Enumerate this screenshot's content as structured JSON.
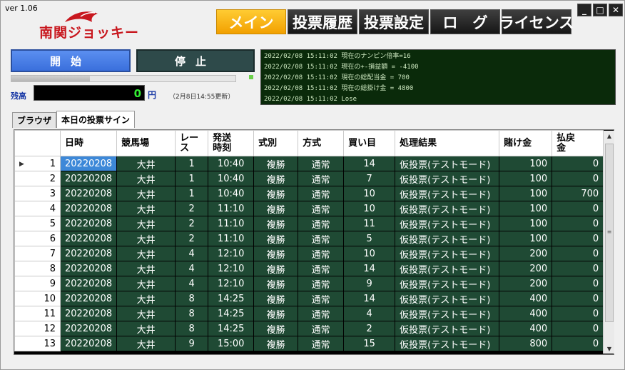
{
  "app": {
    "version": "ver 1.06",
    "logo_text": "南関ジョッキー"
  },
  "nav": {
    "tabs": [
      {
        "label": "メイン",
        "active": true
      },
      {
        "label": "投票履歴",
        "active": false
      },
      {
        "label": "投票設定",
        "active": false
      },
      {
        "label": "ロ　グ",
        "active": false
      },
      {
        "label": "ライセンス",
        "active": false
      }
    ]
  },
  "window_controls": {
    "minimize": "_",
    "maximize": "□",
    "close": "✕"
  },
  "controls": {
    "start_label": "開始",
    "stop_label": "停止",
    "progress_fraction": 0.35
  },
  "balance": {
    "label": "残高",
    "value": "0",
    "unit": "円",
    "note": "（2月8日14:55更新）"
  },
  "log": {
    "lines": [
      "2022/02/08 15:11:02  現在のナンピン倍率=16",
      "2022/02/08 15:11:02  現在の+-損益額 = -4100",
      "2022/02/08 15:11:02  現在の総配当金 = 700",
      "2022/02/08 15:11:02  現在の総掛け金 = 4800",
      "2022/02/08 15:11:02  Lose"
    ]
  },
  "subtabs": [
    {
      "label": "ブラウザ",
      "active": false
    },
    {
      "label": "本日の投票サイン",
      "active": true
    }
  ],
  "table": {
    "headers": [
      "日時",
      "競馬場",
      "レース",
      "発送時刻",
      "式別",
      "方式",
      "買い目",
      "処理結果",
      "賭け金",
      "払戻金"
    ],
    "header_display": [
      "日時",
      "競馬場",
      "レー\nス",
      "発送\n時刻",
      "式別",
      "方式",
      "買い目",
      "処理結果",
      "賭け金",
      "払戻\n金"
    ],
    "rows": [
      {
        "n": "1",
        "date": "20220208",
        "track": "大井",
        "race": "1",
        "time": "10:40",
        "type": "複勝",
        "method": "通常",
        "pick": "14",
        "result": "仮投票(テストモード)",
        "stake": "100",
        "payout": "0"
      },
      {
        "n": "2",
        "date": "20220208",
        "track": "大井",
        "race": "1",
        "time": "10:40",
        "type": "複勝",
        "method": "通常",
        "pick": "7",
        "result": "仮投票(テストモード)",
        "stake": "100",
        "payout": "0"
      },
      {
        "n": "3",
        "date": "20220208",
        "track": "大井",
        "race": "1",
        "time": "10:40",
        "type": "複勝",
        "method": "通常",
        "pick": "10",
        "result": "仮投票(テストモード)",
        "stake": "100",
        "payout": "700"
      },
      {
        "n": "4",
        "date": "20220208",
        "track": "大井",
        "race": "2",
        "time": "11:10",
        "type": "複勝",
        "method": "通常",
        "pick": "10",
        "result": "仮投票(テストモード)",
        "stake": "100",
        "payout": "0"
      },
      {
        "n": "5",
        "date": "20220208",
        "track": "大井",
        "race": "2",
        "time": "11:10",
        "type": "複勝",
        "method": "通常",
        "pick": "11",
        "result": "仮投票(テストモード)",
        "stake": "100",
        "payout": "0"
      },
      {
        "n": "6",
        "date": "20220208",
        "track": "大井",
        "race": "2",
        "time": "11:10",
        "type": "複勝",
        "method": "通常",
        "pick": "5",
        "result": "仮投票(テストモード)",
        "stake": "100",
        "payout": "0"
      },
      {
        "n": "7",
        "date": "20220208",
        "track": "大井",
        "race": "4",
        "time": "12:10",
        "type": "複勝",
        "method": "通常",
        "pick": "10",
        "result": "仮投票(テストモード)",
        "stake": "200",
        "payout": "0"
      },
      {
        "n": "8",
        "date": "20220208",
        "track": "大井",
        "race": "4",
        "time": "12:10",
        "type": "複勝",
        "method": "通常",
        "pick": "14",
        "result": "仮投票(テストモード)",
        "stake": "200",
        "payout": "0"
      },
      {
        "n": "9",
        "date": "20220208",
        "track": "大井",
        "race": "4",
        "time": "12:10",
        "type": "複勝",
        "method": "通常",
        "pick": "9",
        "result": "仮投票(テストモード)",
        "stake": "200",
        "payout": "0"
      },
      {
        "n": "10",
        "date": "20220208",
        "track": "大井",
        "race": "8",
        "time": "14:25",
        "type": "複勝",
        "method": "通常",
        "pick": "14",
        "result": "仮投票(テストモード)",
        "stake": "400",
        "payout": "0"
      },
      {
        "n": "11",
        "date": "20220208",
        "track": "大井",
        "race": "8",
        "time": "14:25",
        "type": "複勝",
        "method": "通常",
        "pick": "4",
        "result": "仮投票(テストモード)",
        "stake": "400",
        "payout": "0"
      },
      {
        "n": "12",
        "date": "20220208",
        "track": "大井",
        "race": "8",
        "time": "14:25",
        "type": "複勝",
        "method": "通常",
        "pick": "2",
        "result": "仮投票(テストモード)",
        "stake": "400",
        "payout": "0"
      },
      {
        "n": "13",
        "date": "20220208",
        "track": "大井",
        "race": "9",
        "time": "15:00",
        "type": "複勝",
        "method": "通常",
        "pick": "15",
        "result": "仮投票(テストモード)",
        "stake": "800",
        "payout": "0"
      }
    ],
    "selected_row": 0
  },
  "colors": {
    "accent": "#f7b500",
    "cell_bg": "#1f4a34",
    "selected": "#3d88d8",
    "log_bg": "#0a2a0a"
  }
}
